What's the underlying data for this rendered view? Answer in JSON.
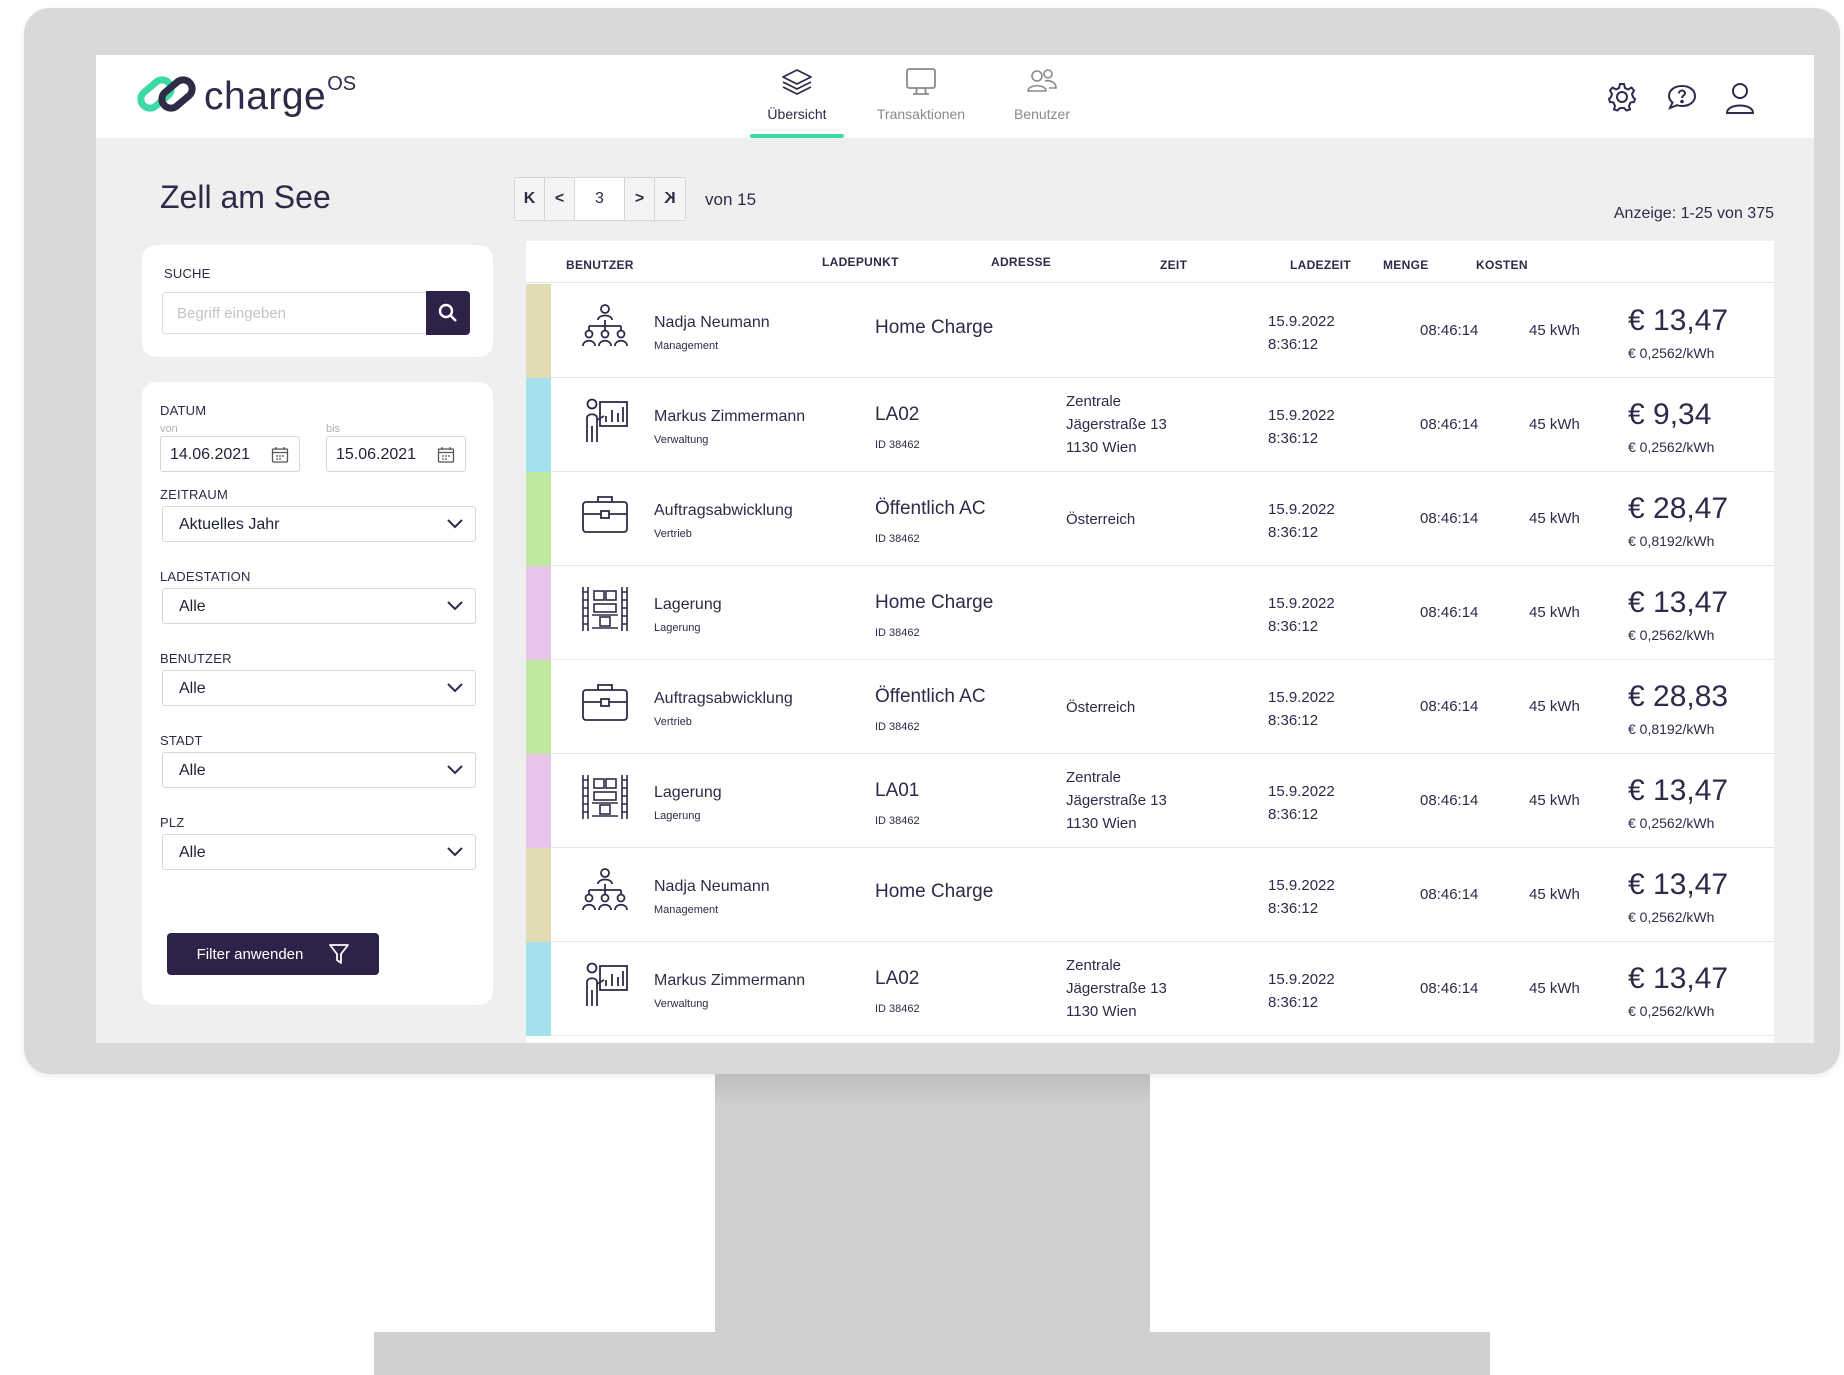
{
  "app": {
    "logo_text": "charge",
    "logo_sup": "OS",
    "accent_color": "#3ddaa6",
    "brand_color": "#2d2348"
  },
  "nav": {
    "tabs": [
      {
        "label": "Übersicht",
        "icon": "layers-icon",
        "active": true
      },
      {
        "label": "Transaktionen",
        "icon": "monitor-icon",
        "active": false
      },
      {
        "label": "Benutzer",
        "icon": "users-icon",
        "active": false
      }
    ],
    "header_icons": [
      "gear-icon",
      "help-chat-icon",
      "user-profile-icon"
    ]
  },
  "sidebar": {
    "city_title": "Zell am See",
    "search": {
      "label": "SUCHE",
      "placeholder": "Begriff eingeben",
      "value": ""
    },
    "date": {
      "label": "DATUM",
      "from_label": "von",
      "from_value": "14.06.2021",
      "to_label": "bis",
      "to_value": "15.06.2021"
    },
    "filters": [
      {
        "label": "ZEITRAUM",
        "value": "Aktuelles Jahr"
      },
      {
        "label": "LADESTATION",
        "value": "Alle"
      },
      {
        "label": "BENUTZER",
        "value": "Alle"
      },
      {
        "label": "STADT",
        "value": "Alle"
      },
      {
        "label": "PLZ",
        "value": "Alle"
      }
    ],
    "apply_button": "Filter anwenden"
  },
  "pagination": {
    "first": "K",
    "prev": "<",
    "current": "3",
    "next": ">",
    "last": "K",
    "total": "von 15",
    "display": "Anzeige: 1-25 von 375"
  },
  "table": {
    "columns": [
      "BENUTZER",
      "LADEPUNKT",
      "ADRESSE",
      "ZEIT",
      "LADEZEIT",
      "MENGE",
      "KOSTEN"
    ],
    "rows": [
      {
        "color": "#e3dbb4",
        "icon": "org-chart-icon",
        "name": "Nadja Neumann",
        "dept": "Management",
        "ladepunkt": "Home Charge",
        "id": "",
        "addr": [],
        "date": "15.9.2022",
        "time": "8:36:12",
        "ladezeit": "08:46:14",
        "menge": "45 kWh",
        "kosten": "€ 13,47",
        "rate": "€ 0,2562/kWh"
      },
      {
        "color": "#a3e2ec",
        "icon": "presentation-icon",
        "name": "Markus Zimmermann",
        "dept": "Verwaltung",
        "ladepunkt": "LA02",
        "id": "ID 38462",
        "addr": [
          "Zentrale",
          "Jägerstraße 13",
          "1130 Wien"
        ],
        "date": "15.9.2022",
        "time": "8:36:12",
        "ladezeit": "08:46:14",
        "menge": "45 kWh",
        "kosten": "€ 9,34",
        "rate": "€ 0,2562/kWh"
      },
      {
        "color": "#bfe9a1",
        "icon": "briefcase-icon",
        "name": "Auftragsabwicklung",
        "dept": "Vertrieb",
        "ladepunkt": "Öffentlich AC",
        "id": "ID 38462",
        "addr": [
          "Österreich"
        ],
        "date": "15.9.2022",
        "time": "8:36:12",
        "ladezeit": "08:46:14",
        "menge": "45 kWh",
        "kosten": "€ 28,47",
        "rate": "€ 0,8192/kWh"
      },
      {
        "color": "#e7c4e8",
        "icon": "warehouse-shelf-icon",
        "name": "Lagerung",
        "dept": "Lagerung",
        "ladepunkt": "Home Charge",
        "id": "ID 38462",
        "addr": [],
        "date": "15.9.2022",
        "time": "8:36:12",
        "ladezeit": "08:46:14",
        "menge": "45 kWh",
        "kosten": "€ 13,47",
        "rate": "€ 0,2562/kWh"
      },
      {
        "color": "#bfe9a1",
        "icon": "briefcase-icon",
        "name": "Auftragsabwicklung",
        "dept": "Vertrieb",
        "ladepunkt": "Öffentlich AC",
        "id": "ID 38462",
        "addr": [
          "Österreich"
        ],
        "date": "15.9.2022",
        "time": "8:36:12",
        "ladezeit": "08:46:14",
        "menge": "45 kWh",
        "kosten": "€ 28,83",
        "rate": "€ 0,8192/kWh"
      },
      {
        "color": "#e7c4e8",
        "icon": "warehouse-shelf-icon",
        "name": "Lagerung",
        "dept": "Lagerung",
        "ladepunkt": "LA01",
        "id": "ID 38462",
        "addr": [
          "Zentrale",
          "Jägerstraße 13",
          "1130 Wien"
        ],
        "date": "15.9.2022",
        "time": "8:36:12",
        "ladezeit": "08:46:14",
        "menge": "45 kWh",
        "kosten": "€ 13,47",
        "rate": "€ 0,2562/kWh"
      },
      {
        "color": "#e3dbb4",
        "icon": "org-chart-icon",
        "name": "Nadja Neumann",
        "dept": "Management",
        "ladepunkt": "Home Charge",
        "id": "",
        "addr": [],
        "date": "15.9.2022",
        "time": "8:36:12",
        "ladezeit": "08:46:14",
        "menge": "45 kWh",
        "kosten": "€ 13,47",
        "rate": "€ 0,2562/kWh"
      },
      {
        "color": "#a3e2ec",
        "icon": "presentation-icon",
        "name": "Markus Zimmermann",
        "dept": "Verwaltung",
        "ladepunkt": "LA02",
        "id": "ID 38462",
        "addr": [
          "Zentrale",
          "Jägerstraße 13",
          "1130 Wien"
        ],
        "date": "15.9.2022",
        "time": "8:36:12",
        "ladezeit": "08:46:14",
        "menge": "45 kWh",
        "kosten": "€ 13,47",
        "rate": "€ 0,2562/kWh"
      }
    ]
  }
}
